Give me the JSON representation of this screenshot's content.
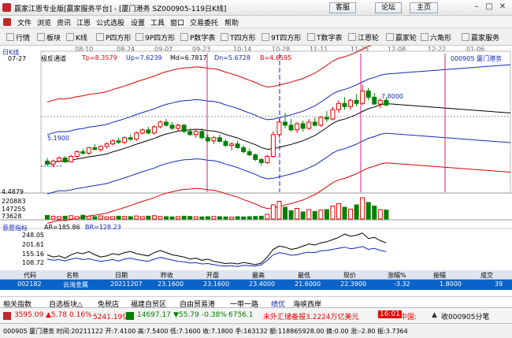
{
  "window": {
    "title": "赢家江恩专业版[赢家服务平台] - [厦门港务  SZ000905-119日K线]",
    "buttons": [
      "客服",
      "论坛",
      "主页"
    ]
  },
  "menu": [
    "文件",
    "浏览",
    "资讯",
    "江恩",
    "公式选股",
    "设置",
    "工具",
    "窗口",
    "交易委托",
    "帮助"
  ],
  "toolbar": [
    "行情",
    "板块",
    "K线",
    "P四方形",
    "9P四方形",
    "P数字表",
    "T四方形",
    "9T四方形",
    "T数字表",
    "江恩轮",
    "赢家轮",
    "六角形",
    "赢家服务"
  ],
  "chart": {
    "period_tag": "日K线",
    "indicator_name": "极反通道",
    "tp": "Tp=8.3579",
    "up": "Up=7.6239",
    "md": "Md=6.7817",
    "dn": "Dn=5.6728",
    "b": "B=4.6595",
    "stock": "000905 厦门港务",
    "price_labels": [
      "7.8000",
      "5.1900",
      "4.4879"
    ],
    "volume_labels": [
      "220883",
      "147255",
      "73628"
    ],
    "date_ticks": [
      "07-27",
      "08-10",
      "08-24",
      "09-07",
      "09-23",
      "10-14",
      "10-28",
      "11-11",
      "11-25",
      "12-08",
      "12-22",
      "01-06"
    ],
    "sub_indicator": "意愿指标",
    "ar": "AR=185.86",
    "br": "BR=128.23",
    "sub_ticks": [
      "248.05",
      "201.61",
      "155.16",
      "108.72"
    ]
  },
  "colors": {
    "up": "#e60000",
    "down": "#008000",
    "band": "#d80000",
    "blue": "#1428b4",
    "accent": "#0a63c8"
  },
  "table": {
    "headers": [
      "代码",
      "名称",
      "日期",
      "昨收",
      "开盘",
      "最高",
      "最低",
      "现价",
      "涨幅%",
      "振幅",
      "成交"
    ],
    "row": [
      "002182",
      "云海金属",
      "20211207",
      "23.1600",
      "23.1600",
      "23.4000",
      "21.6000",
      "22.3900",
      "-3.32",
      "1.8000",
      "39"
    ]
  },
  "blocks": [
    "相关指数",
    "自选板块△",
    "免税店",
    "福建自贸区",
    "自由贸易港",
    "一带一路",
    "绩优",
    "海峡西岸"
  ],
  "ticker": {
    "sh": "3595.09",
    "sh_chg": "▲5.78",
    "sh_pct": "0.16%",
    "sh_amt": "5241.19亿",
    "sz": "14697.17",
    "sz_chg": "▼55.79",
    "sz_pct": "-0.38%",
    "sz_amt": "6756.1",
    "news": "未外汇储备报3.2224万亿美元",
    "time": "16:01",
    "region": "中国:",
    "right": "收000905分笔"
  },
  "status": {
    "text": "000905 厦门港务 时间:20211122 开:7.4100 高:7.5400 低:7.1600 收:7.1800 手:163132 额:118865928.00 换:0.00 涨:-2.80 振:3.7364"
  },
  "series": {
    "ohlc": [
      [
        5.35,
        5.45,
        5.2,
        5.25
      ],
      [
        5.25,
        5.4,
        5.15,
        5.35
      ],
      [
        5.35,
        5.5,
        5.3,
        5.45
      ],
      [
        5.45,
        5.5,
        5.3,
        5.32
      ],
      [
        5.32,
        5.55,
        5.3,
        5.5
      ],
      [
        5.5,
        5.7,
        5.45,
        5.65
      ],
      [
        5.65,
        5.75,
        5.55,
        5.6
      ],
      [
        5.6,
        5.8,
        5.55,
        5.78
      ],
      [
        5.78,
        5.9,
        5.7,
        5.72
      ],
      [
        5.72,
        5.85,
        5.65,
        5.82
      ],
      [
        5.82,
        5.95,
        5.75,
        5.9
      ],
      [
        5.9,
        6.05,
        5.85,
        6.0
      ],
      [
        6.0,
        6.1,
        5.9,
        5.95
      ],
      [
        5.95,
        6.15,
        5.9,
        6.1
      ],
      [
        6.1,
        6.2,
        6.0,
        6.05
      ],
      [
        6.05,
        6.3,
        6.0,
        6.25
      ],
      [
        6.25,
        6.4,
        6.2,
        6.35
      ],
      [
        6.35,
        6.45,
        6.2,
        6.25
      ],
      [
        6.25,
        6.5,
        6.2,
        6.45
      ],
      [
        6.45,
        6.65,
        6.4,
        6.6
      ],
      [
        6.6,
        6.7,
        6.45,
        6.5
      ],
      [
        6.5,
        6.6,
        6.35,
        6.4
      ],
      [
        6.4,
        6.55,
        6.3,
        6.5
      ],
      [
        6.5,
        6.55,
        6.25,
        6.3
      ],
      [
        6.3,
        6.4,
        6.15,
        6.2
      ],
      [
        6.2,
        6.35,
        6.1,
        6.3
      ],
      [
        6.3,
        6.4,
        6.05,
        6.1
      ],
      [
        6.1,
        6.2,
        5.95,
        6.0
      ],
      [
        6.0,
        6.15,
        5.9,
        6.1
      ],
      [
        6.1,
        6.2,
        5.95,
        5.98
      ],
      [
        5.98,
        6.05,
        5.8,
        5.85
      ],
      [
        5.85,
        5.95,
        5.7,
        5.9
      ],
      [
        5.9,
        6.0,
        5.75,
        5.78
      ],
      [
        5.78,
        5.85,
        5.6,
        5.65
      ],
      [
        5.65,
        5.75,
        5.5,
        5.55
      ],
      [
        5.55,
        5.6,
        5.35,
        5.4
      ],
      [
        5.4,
        5.45,
        5.2,
        5.3
      ],
      [
        5.3,
        5.55,
        5.25,
        5.5
      ],
      [
        5.5,
        6.3,
        5.45,
        6.2
      ],
      [
        6.2,
        6.7,
        6.1,
        6.6
      ],
      [
        6.6,
        6.9,
        6.4,
        6.5
      ],
      [
        6.5,
        6.7,
        6.3,
        6.35
      ],
      [
        6.35,
        6.6,
        6.25,
        6.55
      ],
      [
        6.55,
        6.65,
        6.3,
        6.4
      ],
      [
        6.4,
        6.7,
        6.35,
        6.6
      ],
      [
        6.6,
        6.75,
        6.45,
        6.5
      ],
      [
        6.5,
        6.8,
        6.45,
        6.75
      ],
      [
        6.75,
        6.95,
        6.6,
        6.7
      ],
      [
        6.7,
        7.1,
        6.65,
        7.0
      ],
      [
        7.0,
        7.3,
        6.9,
        7.2
      ],
      [
        7.2,
        7.4,
        7.0,
        7.1
      ],
      [
        7.1,
        7.35,
        7.0,
        7.3
      ],
      [
        7.3,
        7.5,
        7.1,
        7.2
      ],
      [
        7.2,
        7.8,
        7.15,
        7.6
      ],
      [
        7.6,
        7.7,
        7.3,
        7.4
      ],
      [
        7.4,
        7.54,
        7.16,
        7.18
      ],
      [
        7.18,
        7.35,
        7.05,
        7.3
      ],
      [
        7.3,
        7.4,
        7.1,
        7.15
      ]
    ],
    "volume": [
      0.15,
      0.12,
      0.1,
      0.12,
      0.14,
      0.1,
      0.16,
      0.12,
      0.1,
      0.13,
      0.09,
      0.1,
      0.12,
      0.11,
      0.1,
      0.13,
      0.1,
      0.12,
      0.14,
      0.11,
      0.1,
      0.09,
      0.1,
      0.12,
      0.11,
      0.1,
      0.09,
      0.1,
      0.11,
      0.1,
      0.09,
      0.08,
      0.1,
      0.09,
      0.1,
      0.11,
      0.12,
      0.2,
      0.6,
      0.75,
      0.5,
      0.35,
      0.45,
      0.3,
      0.4,
      0.32,
      0.38,
      0.4,
      0.55,
      0.65,
      0.5,
      0.42,
      0.6,
      0.9,
      0.7,
      0.55,
      0.4,
      0.38
    ],
    "ar": [
      150,
      140,
      145,
      135,
      150,
      160,
      155,
      165,
      150,
      140,
      145,
      155,
      150,
      160,
      165,
      155,
      150,
      145,
      160,
      170,
      160,
      150,
      145,
      140,
      130,
      135,
      125,
      130,
      120,
      115,
      110,
      112,
      108,
      115,
      110,
      105,
      112,
      140,
      175,
      190,
      185,
      175,
      180,
      190,
      200,
      195,
      205,
      210,
      220,
      230,
      245,
      235,
      240,
      250,
      225,
      230,
      215,
      205
    ],
    "br": [
      130,
      125,
      128,
      122,
      130,
      135,
      128,
      132,
      125,
      120,
      124,
      128,
      122,
      130,
      135,
      128,
      124,
      120,
      130,
      138,
      132,
      126,
      120,
      118,
      112,
      114,
      108,
      110,
      105,
      100,
      98,
      100,
      96,
      102,
      100,
      98,
      104,
      125,
      150,
      160,
      155,
      148,
      150,
      158,
      162,
      160,
      168,
      170,
      175,
      180,
      185,
      178,
      182,
      188,
      175,
      180,
      170,
      165
    ]
  }
}
